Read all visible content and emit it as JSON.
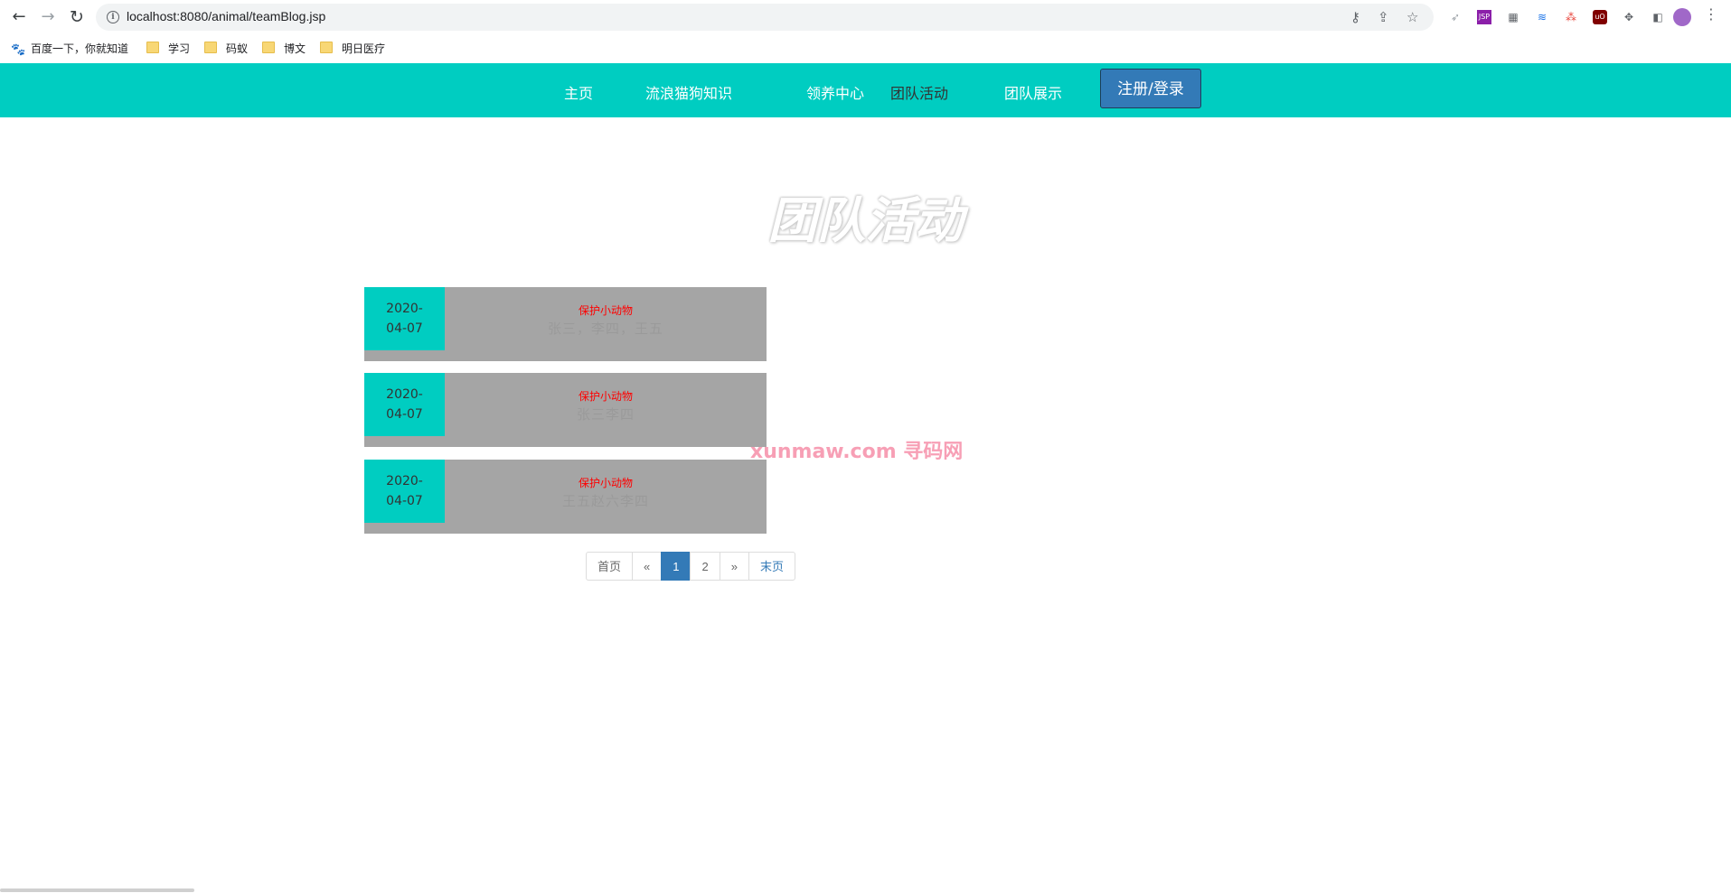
{
  "browser": {
    "url": "localhost:8080/animal/teamBlog.jsp",
    "bookmarks": [
      {
        "label": "百度一下，你就知道",
        "icon": "baidu-icon"
      },
      {
        "label": "学习",
        "icon": "folder-icon"
      },
      {
        "label": "码蚁",
        "icon": "folder-icon"
      },
      {
        "label": "博文",
        "icon": "folder-icon"
      },
      {
        "label": "明日医疗",
        "icon": "folder-icon"
      }
    ]
  },
  "navbar": {
    "items": [
      {
        "label": "主页"
      },
      {
        "label": "流浪猫狗知识"
      },
      {
        "label": "领养中心"
      },
      {
        "label": "团队活动"
      },
      {
        "label": "团队展示"
      }
    ],
    "login_label": "注册/登录",
    "bg_color": "#00cdc1"
  },
  "page": {
    "title": "团队活动"
  },
  "blogs": [
    {
      "date_line1": "2020-",
      "date_line2": "04-07",
      "title": "保护小动物",
      "authors": "张三，李四，王五"
    },
    {
      "date_line1": "2020-",
      "date_line2": "04-07",
      "title": "保护小动物",
      "authors": "张三李四"
    },
    {
      "date_line1": "2020-",
      "date_line2": "04-07",
      "title": "保护小动物",
      "authors": "王五赵六李四"
    }
  ],
  "pagination": {
    "first": "首页",
    "prev": "«",
    "pages": [
      "1",
      "2"
    ],
    "current": "1",
    "next": "»",
    "last": "末页"
  },
  "watermark": "xunmaw.com 寻码网",
  "colors": {
    "accent": "#00cdc1",
    "primary": "#337ab7",
    "card_bg": "#a5a5a5",
    "title_red": "#ff0000"
  }
}
